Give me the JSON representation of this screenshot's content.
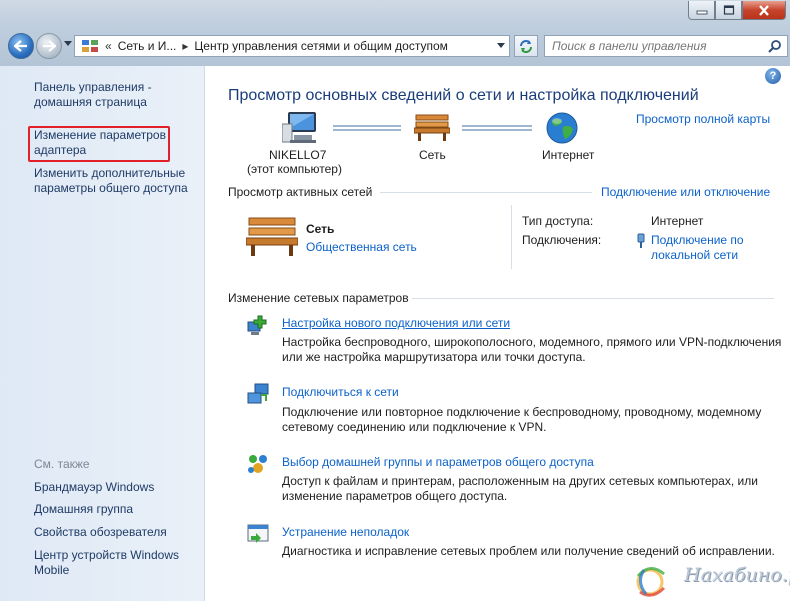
{
  "address": {
    "crumb_overflow": "«",
    "crumb_1": "Сеть и И...",
    "crumb_sep": "▸",
    "crumb_2": "Центр управления сетями и общим доступом"
  },
  "search": {
    "placeholder": "Поиск в панели управления"
  },
  "sidebar": {
    "home_link": "Панель управления - домашняя страница",
    "adapter_link": "Изменение параметров адаптера",
    "sharing_link": "Изменить дополнительные параметры общего доступа",
    "see_also": "См. также",
    "see_also_items": [
      "Брандмауэр Windows",
      "Домашняя группа",
      "Свойства обозревателя",
      "Центр устройств Windows Mobile"
    ]
  },
  "main": {
    "title": "Просмотр основных сведений о сети и настройка подключений",
    "full_map_link": "Просмотр полной карты",
    "map": {
      "computer_name": "NIKELLO7",
      "computer_sub": "(этот компьютер)",
      "network": "Сеть",
      "internet": "Интернет"
    },
    "active_section": "Просмотр активных сетей",
    "connect_disconnect_link": "Подключение или отключение",
    "active": {
      "network_name": "Сеть",
      "network_type": "Общественная сеть",
      "access_type_label": "Тип доступа:",
      "access_type_value": "Интернет",
      "connections_label": "Подключения:",
      "connection_value": "Подключение по локальной сети"
    },
    "change_section": "Изменение сетевых параметров",
    "tasks": [
      {
        "title": "Настройка нового подключения или сети",
        "desc": "Настройка беспроводного, широкополосного, модемного, прямого или VPN-подключения или же настройка маршрутизатора или точки доступа."
      },
      {
        "title": "Подключиться к сети",
        "desc": "Подключение или повторное подключение к беспроводному, проводному, модемному сетевому соединению или подключение к VPN."
      },
      {
        "title": "Выбор домашней группы и параметров общего доступа",
        "desc": "Доступ к файлам и принтерам, расположенным на других сетевых компьютерах, или изменение параметров общего доступа."
      },
      {
        "title": "Устранение неполадок",
        "desc": "Диагностика и исправление сетевых проблем или получение сведений об исправлении."
      }
    ]
  },
  "watermark": "Нахабино.ру",
  "colors": {
    "link": "#0b61c9",
    "heading": "#1a3d7a",
    "sidebar_bg": "#e4edf7",
    "highlight": "#e2202a"
  }
}
